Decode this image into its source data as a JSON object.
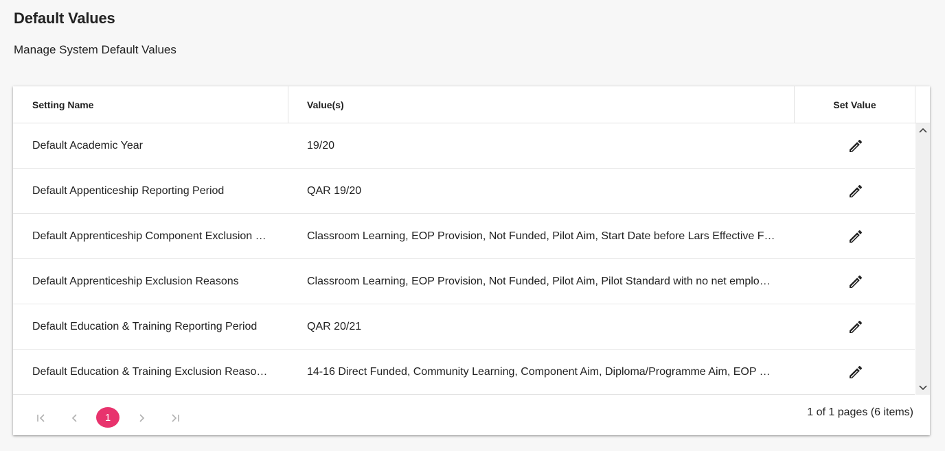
{
  "page": {
    "title": "Default Values",
    "subtitle": "Manage System Default Values"
  },
  "grid": {
    "columns": [
      "Setting Name",
      "Value(s)",
      "Set Value"
    ],
    "rows": [
      {
        "name": "Default Academic Year",
        "value": "19/20"
      },
      {
        "name": "Default Appenticeship Reporting Period",
        "value": "QAR 19/20"
      },
      {
        "name": "Default Apprenticeship Component Exclusion …",
        "value": "Classroom Learning, EOP Provision, Not Funded, Pilot Aim, Start Date before Lars Effective Fr…"
      },
      {
        "name": "Default Apprenticeship Exclusion Reasons",
        "value": "Classroom Learning, EOP Provision, Not Funded, Pilot Aim, Pilot Standard with no net employ…"
      },
      {
        "name": "Default Education & Training Reporting Period",
        "value": "QAR 20/21"
      },
      {
        "name": "Default Education & Training Exclusion Reasons",
        "value": "14-16 Direct Funded, Community Learning, Component Aim, Diploma/Programme Aim, EOP P…"
      }
    ],
    "row_action_icon": "pencil-edit-icon"
  },
  "pager": {
    "current_page": "1",
    "info": "1 of 1 pages (6 items)",
    "icons": [
      "first-page-icon",
      "previous-page-icon",
      "next-page-icon",
      "last-page-icon"
    ]
  },
  "colors": {
    "accent": "#e8336d",
    "background": "#f7f7f7",
    "text": "#212121",
    "pager_disabled": "#b0b0b0"
  }
}
